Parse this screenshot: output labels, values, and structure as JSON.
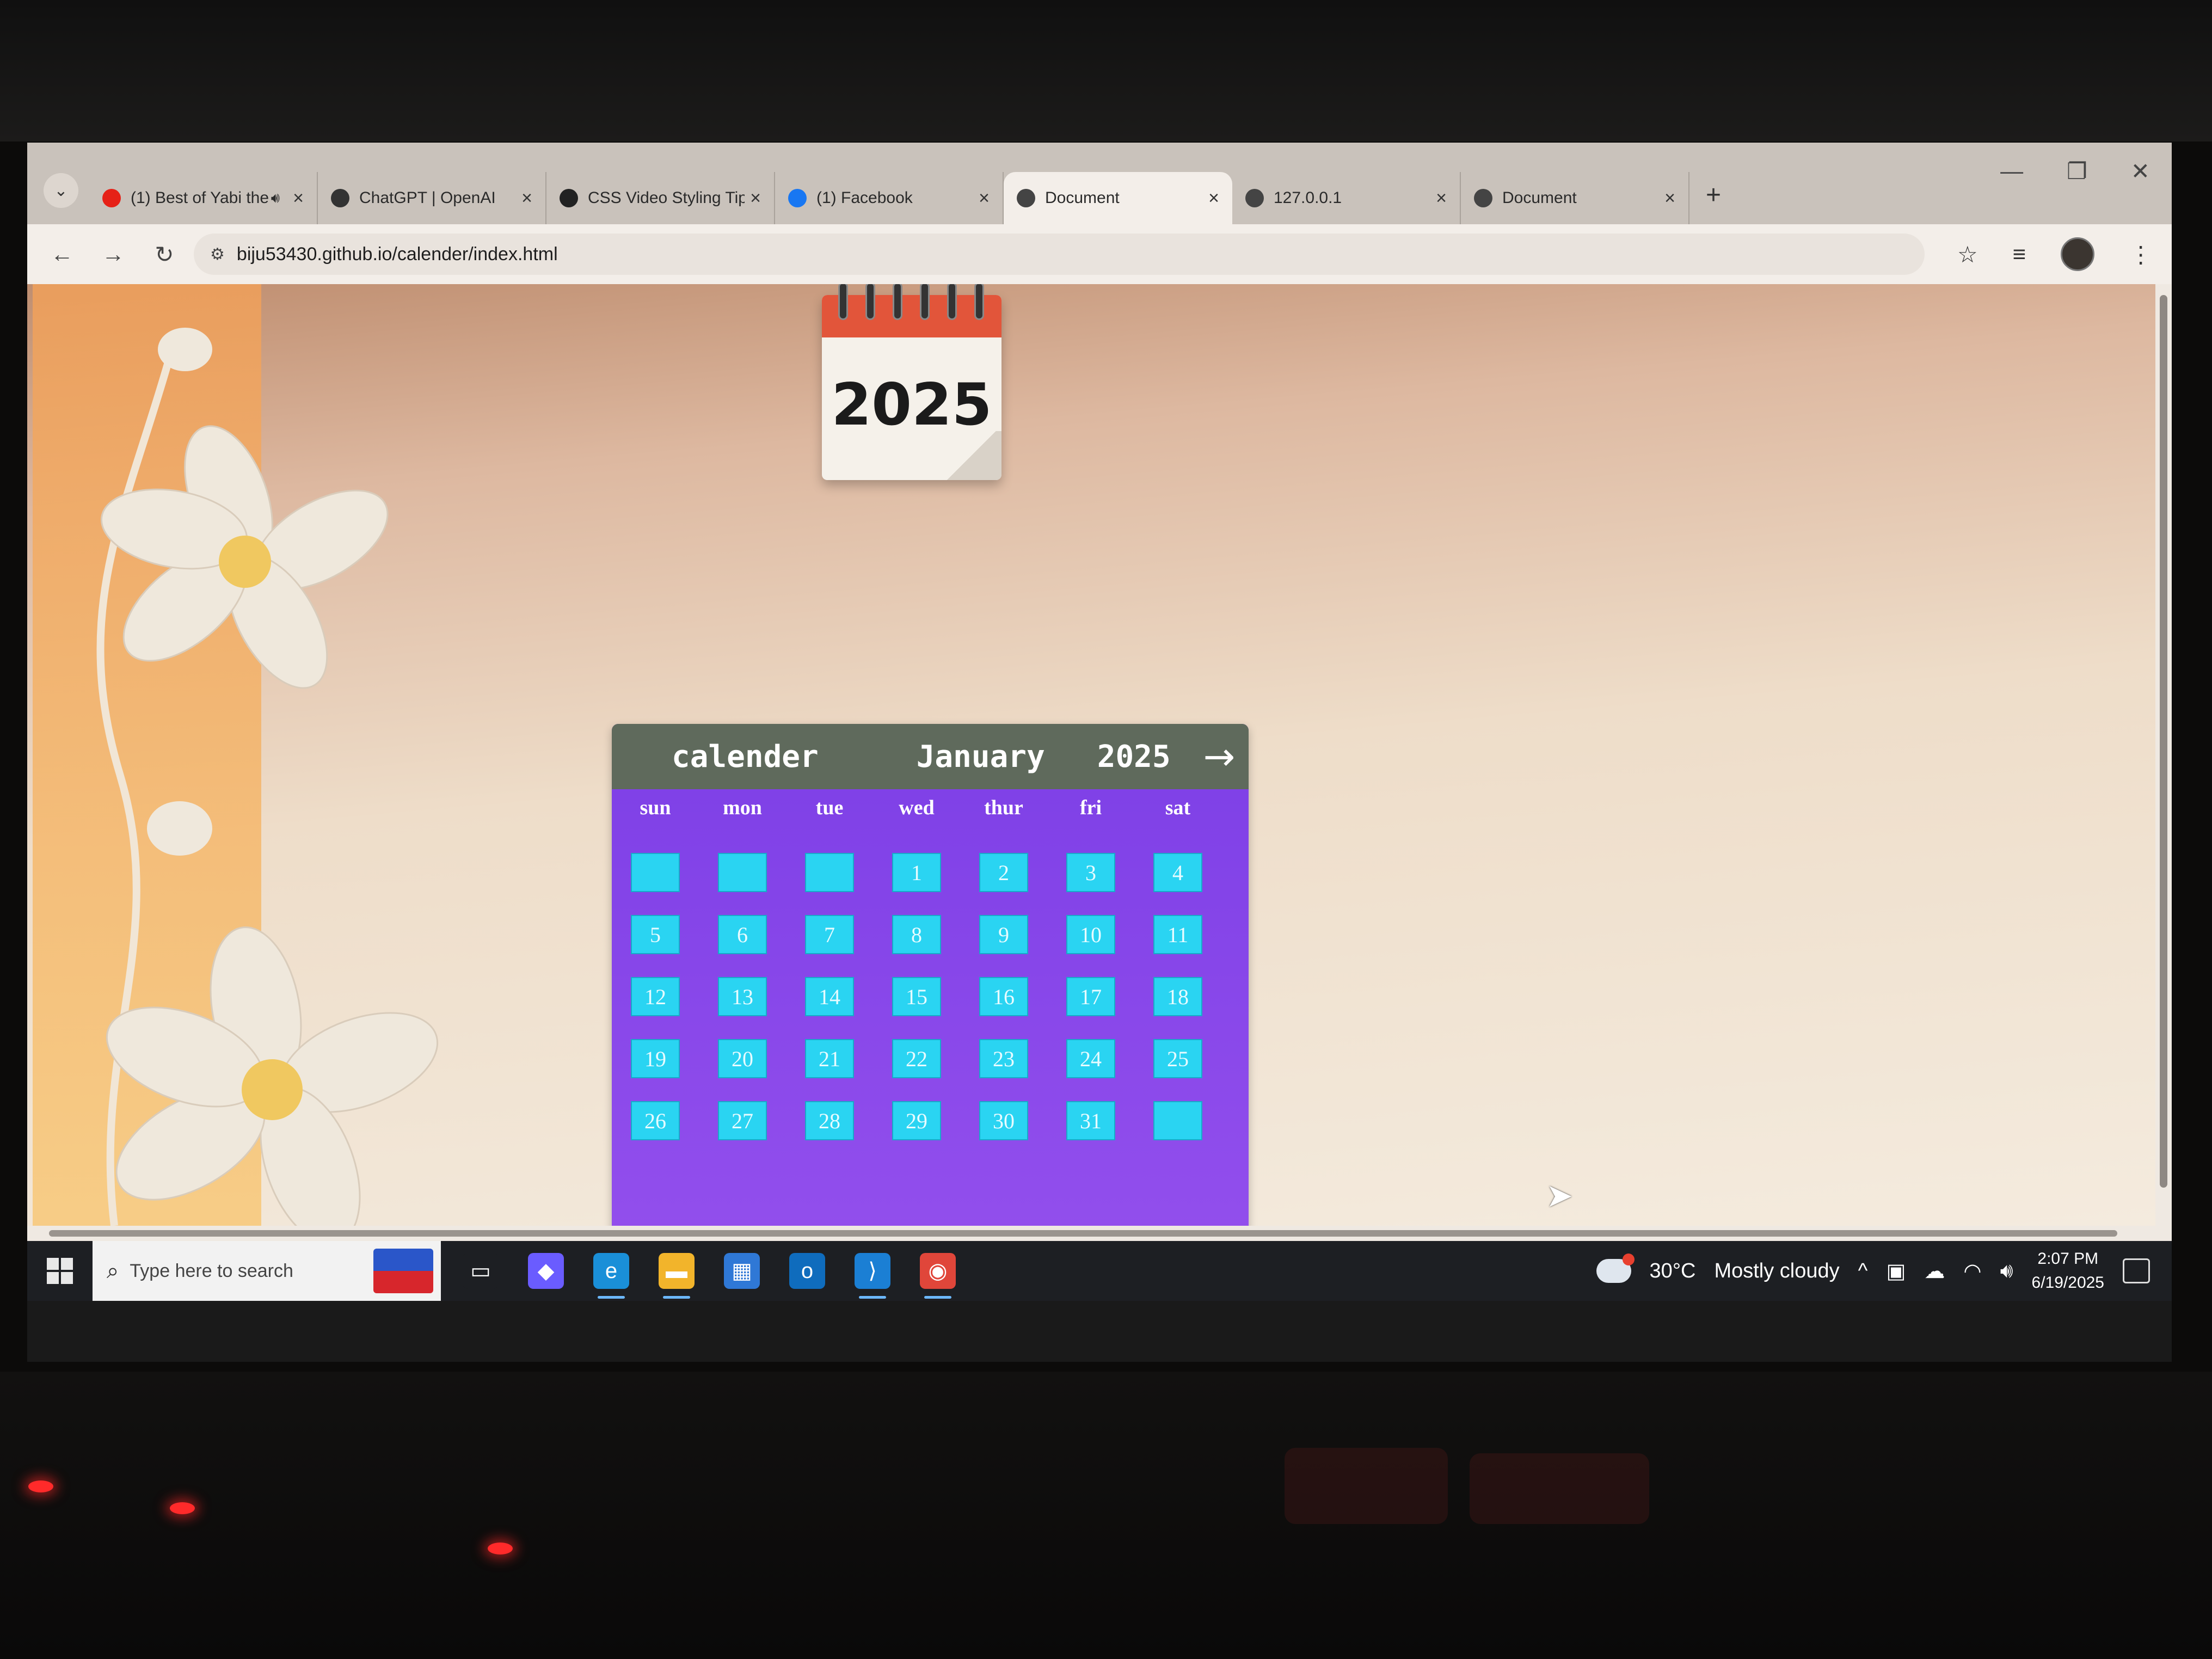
{
  "browser": {
    "tabs": [
      {
        "title": "(1) Best of Yabi the",
        "favicon": "youtube-icon",
        "favicon_color": "#e62117",
        "audio": true,
        "active": false
      },
      {
        "title": "ChatGPT | OpenAI",
        "favicon": "chatgpt-icon",
        "favicon_color": "#333333",
        "active": false
      },
      {
        "title": "CSS Video Styling Tips",
        "favicon": "circle-icon",
        "favicon_color": "#222222",
        "active": false
      },
      {
        "title": "(1) Facebook",
        "favicon": "facebook-icon",
        "favicon_color": "#1877f2",
        "active": false
      },
      {
        "title": "Document",
        "favicon": "globe-icon",
        "favicon_color": "#444444",
        "active": true
      },
      {
        "title": "127.0.0.1",
        "favicon": "globe-icon",
        "favicon_color": "#444444",
        "active": false
      },
      {
        "title": "Document",
        "favicon": "globe-icon",
        "favicon_color": "#444444",
        "active": false
      }
    ],
    "url": "biju53430.github.io/calender/index.html"
  },
  "page": {
    "icon_year": "2025",
    "calendar": {
      "title": "calender",
      "month": "January",
      "year": "2025",
      "next_symbol": "→",
      "weekdays": [
        "sun",
        "mon",
        "tue",
        "wed",
        "thur",
        "fri",
        "sat"
      ],
      "days": [
        "",
        "",
        "",
        "1",
        "2",
        "3",
        "4",
        "5",
        "6",
        "7",
        "8",
        "9",
        "10",
        "11",
        "12",
        "13",
        "14",
        "15",
        "16",
        "17",
        "18",
        "19",
        "20",
        "21",
        "22",
        "23",
        "24",
        "25",
        "26",
        "27",
        "28",
        "29",
        "30",
        "31",
        ""
      ],
      "colors": {
        "header": "#5f6a5c",
        "body": "#8a48eb",
        "day": "#2ad4f2"
      }
    }
  },
  "taskbar": {
    "search_placeholder": "Type here to search",
    "apps": [
      "task-view-icon",
      "copilot-icon",
      "edge-icon",
      "file-explorer-icon",
      "store-icon",
      "outlook-icon",
      "vscode-icon",
      "chrome-icon"
    ],
    "weather": {
      "temp": "30°C",
      "condition": "Mostly cloudy"
    },
    "time": "2:07 PM",
    "date": "6/19/2025"
  }
}
